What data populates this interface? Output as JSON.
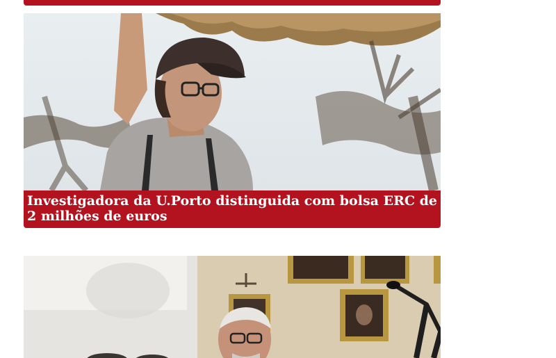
{
  "articles": [
    {
      "title": "Investigadora da U.Porto distinguida com bolsa ERC de 2 milhões de euros",
      "image": "researcher-portrait-photo"
    },
    {
      "title": "",
      "image": "ceremony-speaker-photo"
    }
  ],
  "colors": {
    "accent": "#b3121f",
    "caption_text": "#ffffff",
    "background": "#ffffff"
  }
}
